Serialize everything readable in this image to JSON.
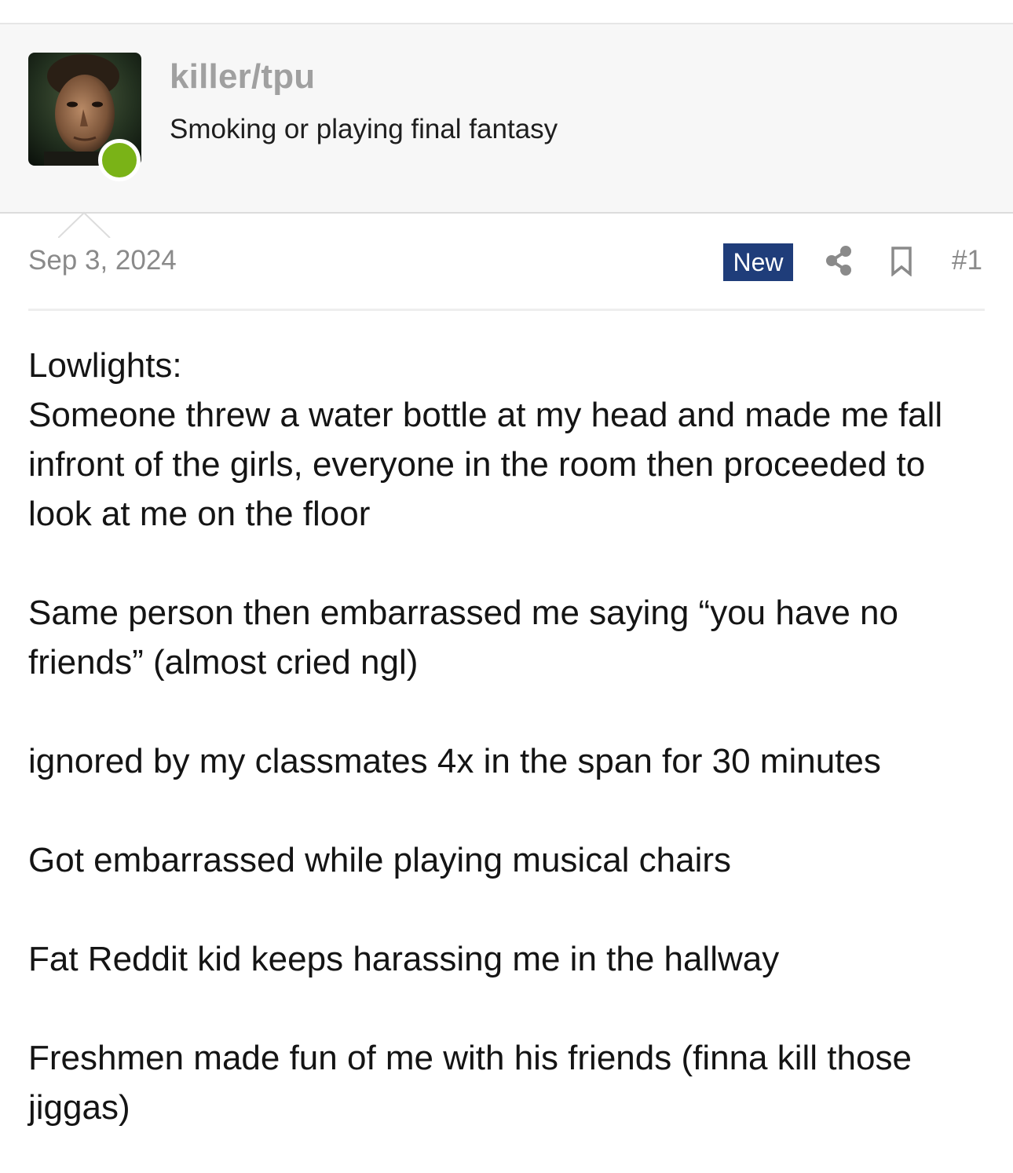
{
  "user": {
    "username": "killer/tpu",
    "title": "Smoking or playing final fantasy",
    "online_status_color": "#7ab317",
    "avatar_icon": "user-avatar-photo"
  },
  "post": {
    "date": "Sep 3, 2024",
    "badge": "New",
    "number": "#1",
    "actions": {
      "share_icon": "share-icon",
      "bookmark_icon": "bookmark-icon"
    },
    "body": {
      "heading": "Lowlights:",
      "paragraph_1": "Someone threw a water bottle at my head and made me fall infront of the girls, everyone in the room then proceeded to look at me on the floor",
      "paragraph_2": "Same person then embarrassed me saying “you have no friends” (almost cried ngl)",
      "paragraph_3": "ignored by my classmates 4x in the span for 30 minutes",
      "paragraph_4": "Got embarrassed while playing musical chairs",
      "paragraph_5": "Fat Reddit kid keeps harassing me in the hallway",
      "paragraph_6": "Freshmen made fun of me with his friends (finna kill those jiggas)"
    }
  },
  "colors": {
    "badge_background": "#1f3d7a",
    "header_background": "#f7f7f7",
    "muted_text": "#8a8a8a"
  }
}
